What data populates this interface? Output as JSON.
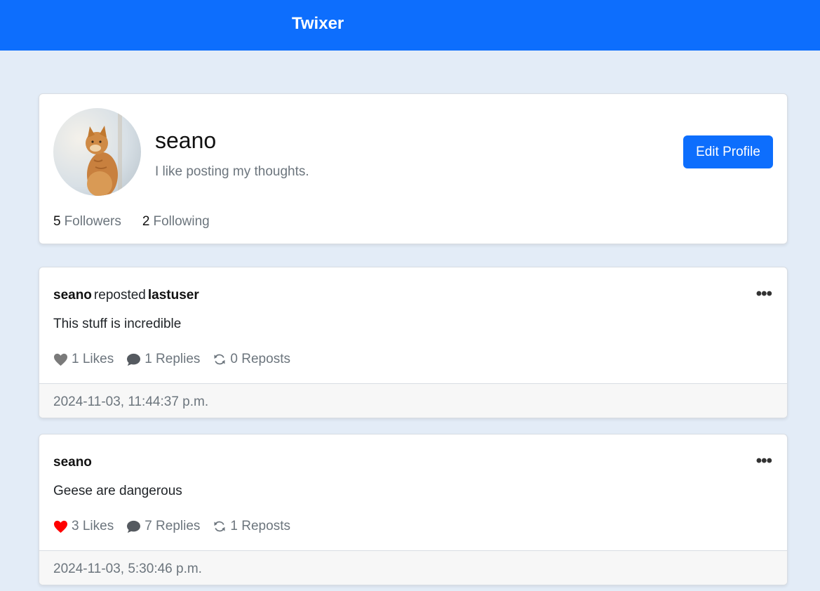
{
  "navbar": {
    "brand": "Twixer",
    "color": "#0d6efd"
  },
  "profile": {
    "username": "seano",
    "bio": "I like posting my thoughts.",
    "edit_button": "Edit Profile",
    "followers_count": "5",
    "followers_label": "Followers",
    "following_count": "2",
    "following_label": "Following"
  },
  "posts": [
    {
      "author": "seano",
      "repost_verb": "reposted",
      "original_author": "lastuser",
      "text": "This stuff is incredible",
      "likes": "1 Likes",
      "liked": false,
      "replies": "1 Replies",
      "reposts": "0 Reposts",
      "timestamp": "2024-11-03, 11:44:37 p.m.",
      "menu_icon": "ellipsis-icon"
    },
    {
      "author": "seano",
      "text": "Geese are dangerous",
      "likes": "3 Likes",
      "liked": true,
      "replies": "7 Replies",
      "reposts": "1 Reposts",
      "timestamp": "2024-11-03, 5:30:46 p.m.",
      "menu_icon": "ellipsis-icon"
    }
  ],
  "colors": {
    "liked_heart": "#ff0000",
    "unliked_heart": "#7a7a7a"
  }
}
